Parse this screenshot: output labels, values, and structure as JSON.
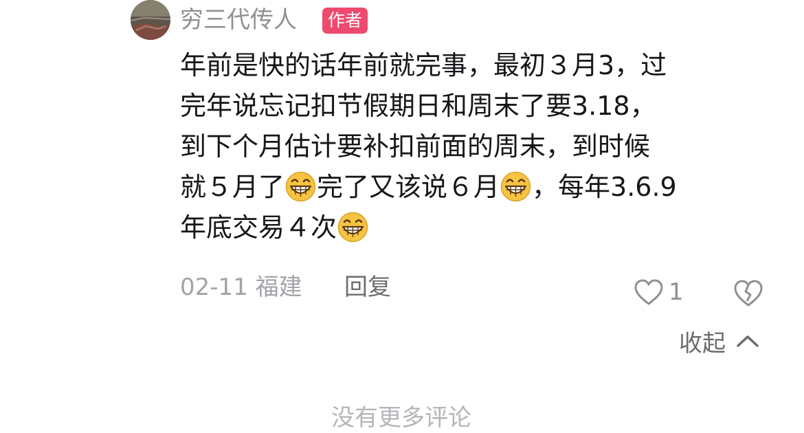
{
  "comment": {
    "author": {
      "name": "穷三代传人",
      "badge": "作者",
      "avatar_icon": "avatar-photo"
    },
    "body_lines": [
      [
        {
          "text": "年前是快的话年前就完事，最初３月3，过"
        }
      ],
      [
        {
          "text": "完年说忘记扣节假期日和周末了要3.18，"
        }
      ],
      [
        {
          "text": "到下个月估计要补扣前面的周末，到时候"
        }
      ],
      [
        {
          "text": "就５月了"
        },
        {
          "emoji": "grinning-face"
        },
        {
          "text": "完了又该说６月"
        },
        {
          "emoji": "grinning-face"
        },
        {
          "text": "，每年3.6.9"
        }
      ],
      [
        {
          "text": "年底交易４次"
        },
        {
          "emoji": "grinning-face"
        }
      ]
    ],
    "meta": {
      "date_location": "02-11 福建",
      "reply_label": "回复"
    },
    "actions": {
      "like_icon": "heart-outline-icon",
      "like_count": "1",
      "dislike_icon": "broken-heart-icon"
    },
    "collapse": {
      "label": "收起",
      "icon": "chevron-up-icon"
    }
  },
  "footer": {
    "no_more_text": "没有更多评论"
  },
  "colors": {
    "badge_bg": "#ee4a6e",
    "text_primary": "#16161a",
    "text_secondary": "#8f8f94",
    "emoji_yellow": "#f7c342"
  }
}
